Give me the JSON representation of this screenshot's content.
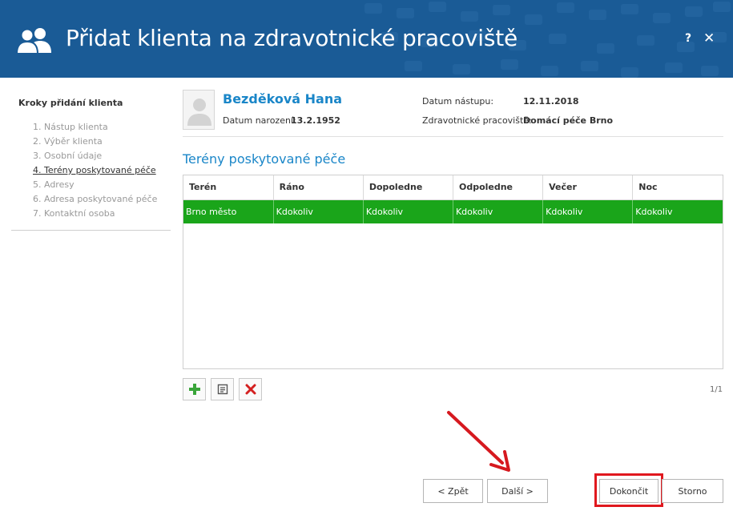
{
  "header": {
    "title": "Přidat klienta na zdravotnické pracoviště",
    "help_label": "?",
    "close_label": "✕",
    "background_color": "#1a5b96",
    "icon": "users-icon"
  },
  "sidebar": {
    "heading": "Kroky přidání klienta",
    "steps": [
      {
        "label": "1. Nástup klienta",
        "active": false
      },
      {
        "label": "2. Výběr klienta",
        "active": false
      },
      {
        "label": "3. Osobní údaje",
        "active": false
      },
      {
        "label": "4. Terény poskytované péče",
        "active": true
      },
      {
        "label": "5. Adresy",
        "active": false
      },
      {
        "label": "6. Adresa poskytované péče",
        "active": false
      },
      {
        "label": "7. Kontaktní osoba",
        "active": false
      }
    ]
  },
  "client": {
    "name": "Bezděková Hana",
    "birth_label": "Datum narození:",
    "birth_value": "13.2.1952",
    "start_label": "Datum nástupu:",
    "start_value": "12.11.2018",
    "workplace_label": "Zdravotnické pracoviště:",
    "workplace_value": "Domácí péče Brno"
  },
  "section": {
    "title": "Terény poskytované péče"
  },
  "grid": {
    "columns": [
      "Terén",
      "Ráno",
      "Dopoledne",
      "Odpoledne",
      "Večer",
      "Noc"
    ],
    "rows": [
      [
        "Brno město",
        "Kdokoliv",
        "Kdokoliv",
        "Kdokoliv",
        "Kdokoliv",
        "Kdokoliv"
      ]
    ],
    "selected_row_color": "#1aa51a"
  },
  "toolbar": {
    "add_icon": "plus-icon",
    "edit_icon": "edit-icon",
    "delete_icon": "delete-icon",
    "pager": "1/1"
  },
  "footer": {
    "back_label": "< Zpět",
    "next_label": "Další >",
    "finish_label": "Dokončit",
    "cancel_label": "Storno"
  },
  "annotation": {
    "color": "#e0181e"
  }
}
